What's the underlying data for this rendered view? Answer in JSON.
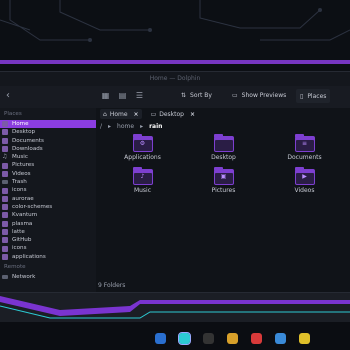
{
  "window": {
    "title": "Home — Dolphin"
  },
  "toolbar": {
    "back_icon": "back-arrow-icon",
    "sort_label": "Sort By",
    "preview_label": "Show Previews",
    "places_label": "Places"
  },
  "sidebar": {
    "places_heading": "Places",
    "places": [
      {
        "label": "Home",
        "icon": "home-icon",
        "active": true
      },
      {
        "label": "Desktop",
        "icon": "desktop-folder-icon"
      },
      {
        "label": "Documents",
        "icon": "documents-folder-icon"
      },
      {
        "label": "Downloads",
        "icon": "downloads-folder-icon"
      },
      {
        "label": "Music",
        "icon": "music-note-icon"
      },
      {
        "label": "Pictures",
        "icon": "pictures-folder-icon"
      },
      {
        "label": "Videos",
        "icon": "videos-folder-icon"
      },
      {
        "label": "Trash",
        "icon": "trash-icon"
      },
      {
        "label": "icons",
        "icon": "folder-icon"
      },
      {
        "label": "aurorae",
        "icon": "folder-icon"
      },
      {
        "label": "color-schemes",
        "icon": "folder-icon"
      },
      {
        "label": "Kvantum",
        "icon": "folder-icon"
      },
      {
        "label": "plasma",
        "icon": "folder-icon"
      },
      {
        "label": "latte",
        "icon": "folder-icon"
      },
      {
        "label": "GitHub",
        "icon": "folder-icon"
      },
      {
        "label": "icons",
        "icon": "folder-icon"
      },
      {
        "label": "applications",
        "icon": "folder-icon"
      }
    ],
    "remote_heading": "Remote",
    "remote": [
      {
        "label": "Network",
        "icon": "network-icon"
      }
    ]
  },
  "tabs": [
    {
      "label": "Home",
      "icon": "home-icon",
      "active": true
    },
    {
      "label": "Desktop",
      "icon": "desktop-icon",
      "active": false
    }
  ],
  "path": {
    "root": "/",
    "home": "home",
    "current": "rain"
  },
  "folders": [
    {
      "label": "Applications",
      "glyph": "⚙"
    },
    {
      "label": "Desktop",
      "glyph": ""
    },
    {
      "label": "Documents",
      "glyph": "≡"
    },
    {
      "label": "Music",
      "glyph": "♪"
    },
    {
      "label": "Pictures",
      "glyph": "▣"
    },
    {
      "label": "Videos",
      "glyph": "▶"
    }
  ],
  "status": {
    "text": "9 Folders"
  },
  "colors": {
    "accent": "#8b3de0",
    "folder": "#7d3fd0"
  }
}
